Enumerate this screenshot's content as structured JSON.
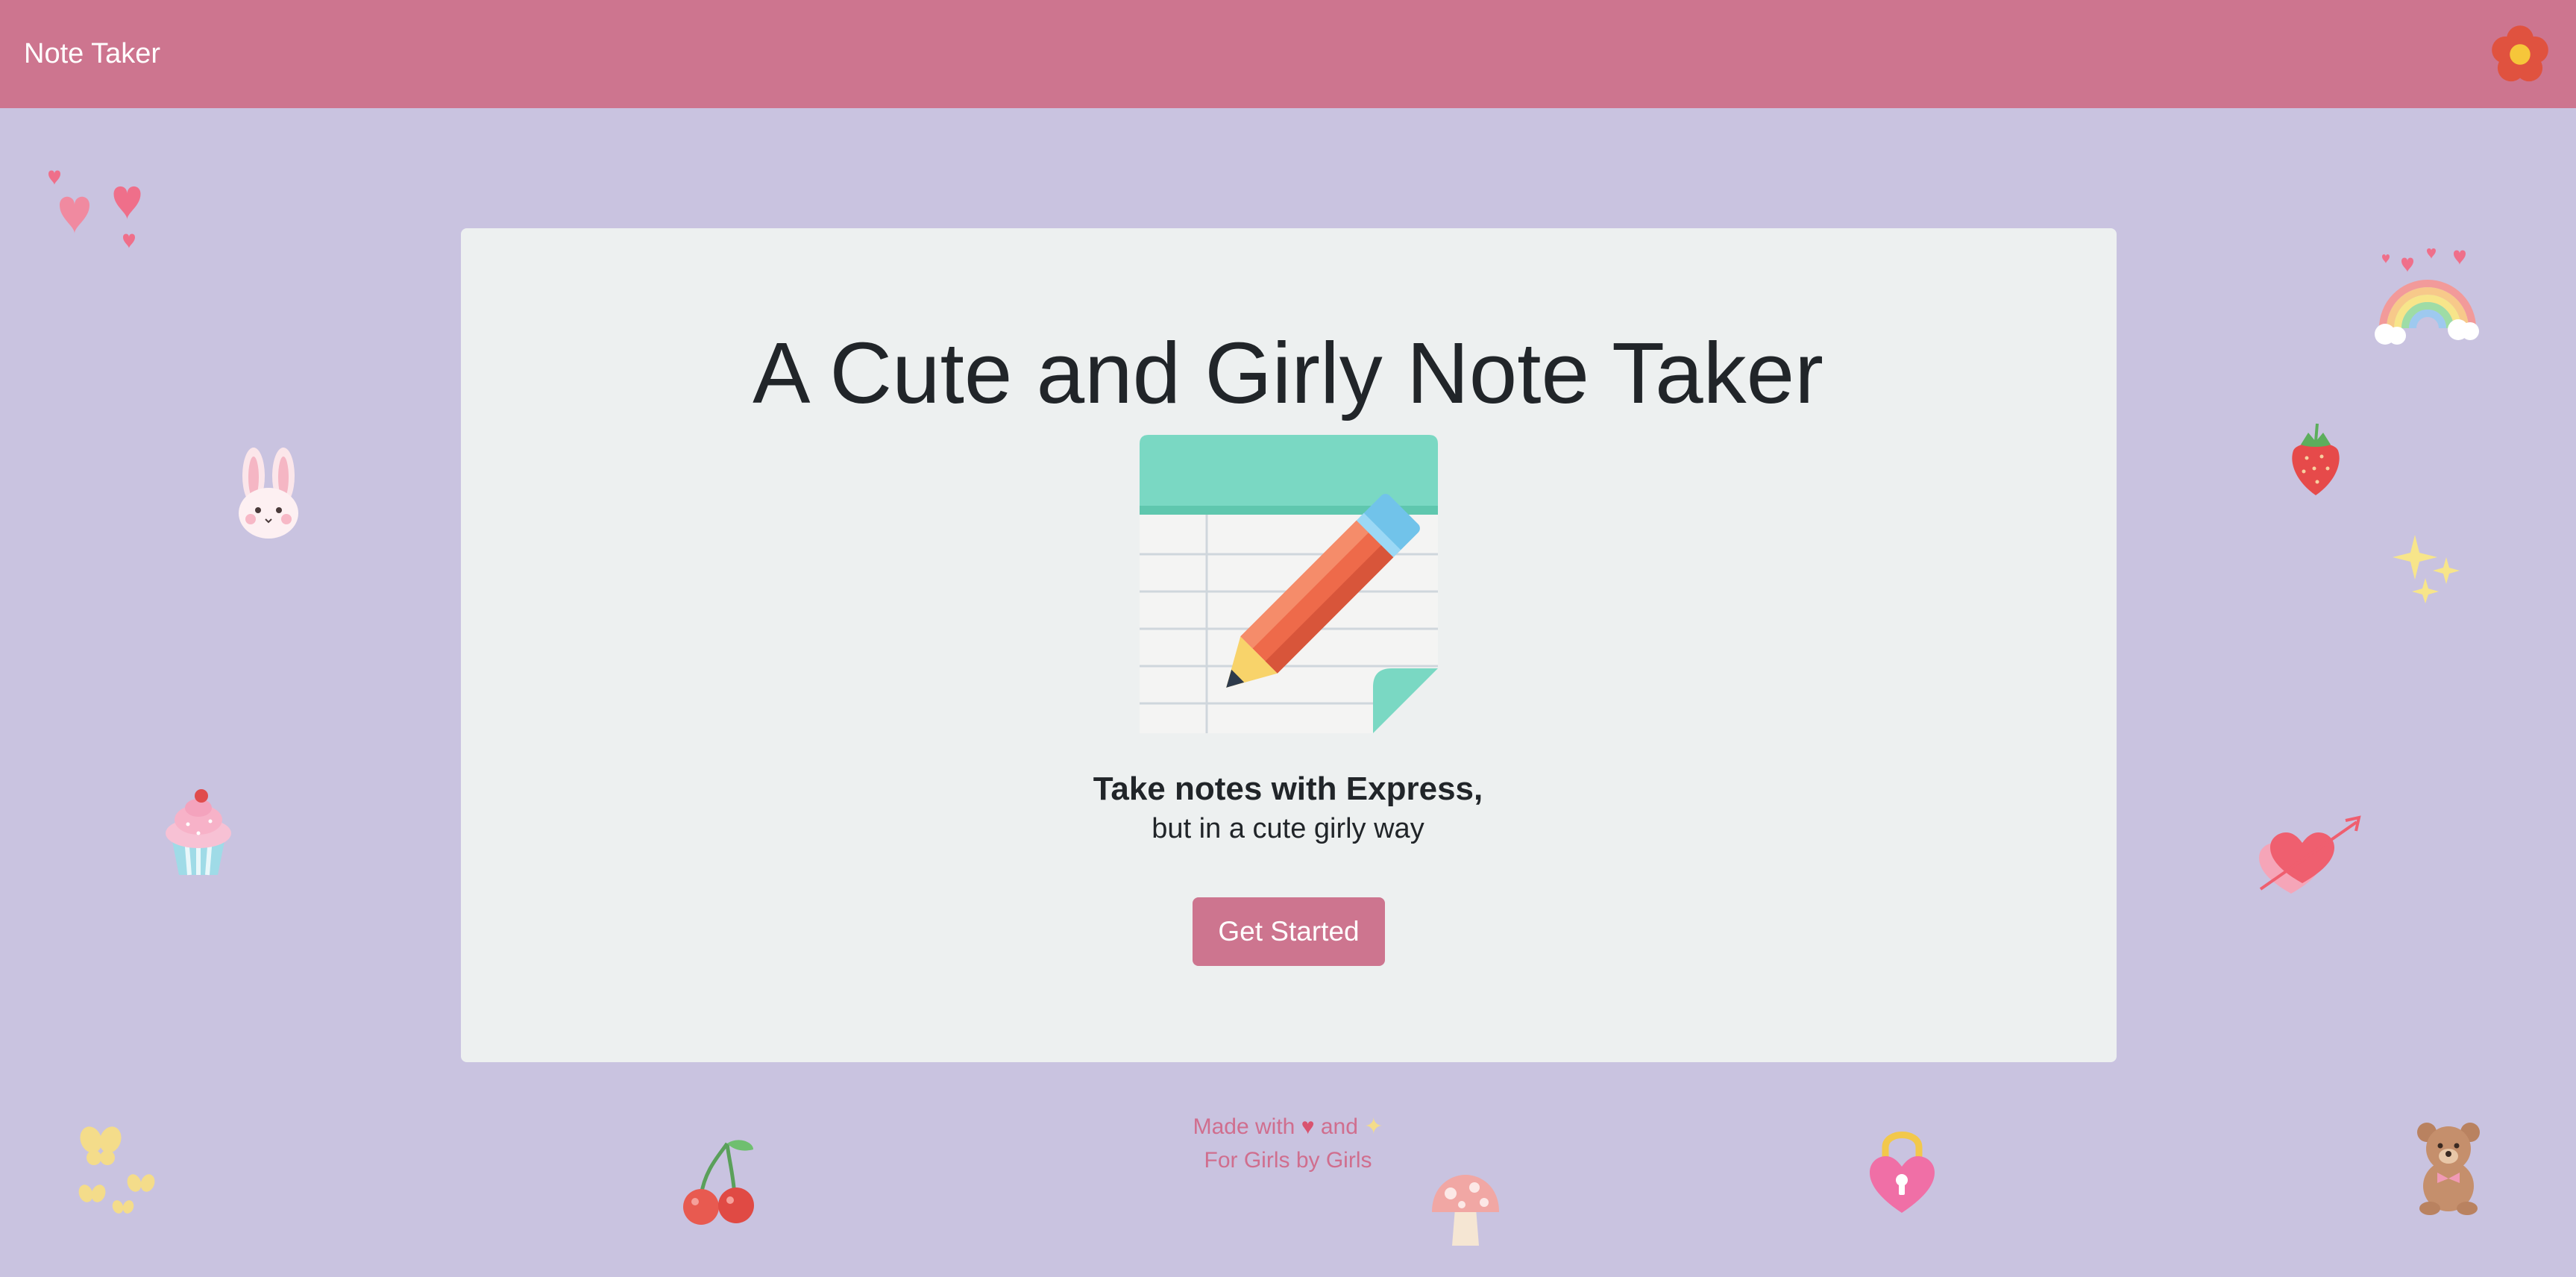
{
  "navbar": {
    "brand": "Note Taker",
    "menu_icon": "flower-icon"
  },
  "hero": {
    "title": "A Cute and Girly Note Taker",
    "illustration": "notepad-pencil-icon",
    "lead": "Take notes with Express,",
    "subtitle": "but in a cute girly way",
    "cta_label": "Get Started"
  },
  "footer": {
    "made_with": "Made with",
    "and_word": "and",
    "tagline": "For Girls by Girls",
    "heart_icon": "heart-icon",
    "sparkle_icon": "sparkle-icon"
  },
  "decorations": [
    "hearts-icon",
    "bunny-icon",
    "cupcake-icon",
    "butterflies-icon",
    "cherry-icon",
    "mushroom-icon",
    "heart-lock-icon",
    "teddy-bear-icon",
    "rainbow-icon",
    "strawberry-icon",
    "sparkles-icon",
    "heart-arrow-icon"
  ],
  "colors": {
    "navbar": "#cd758f",
    "background": "#c9c3e0",
    "card": "#edf0f0",
    "button": "#cd758f",
    "footer_text": "#d06e8e"
  }
}
